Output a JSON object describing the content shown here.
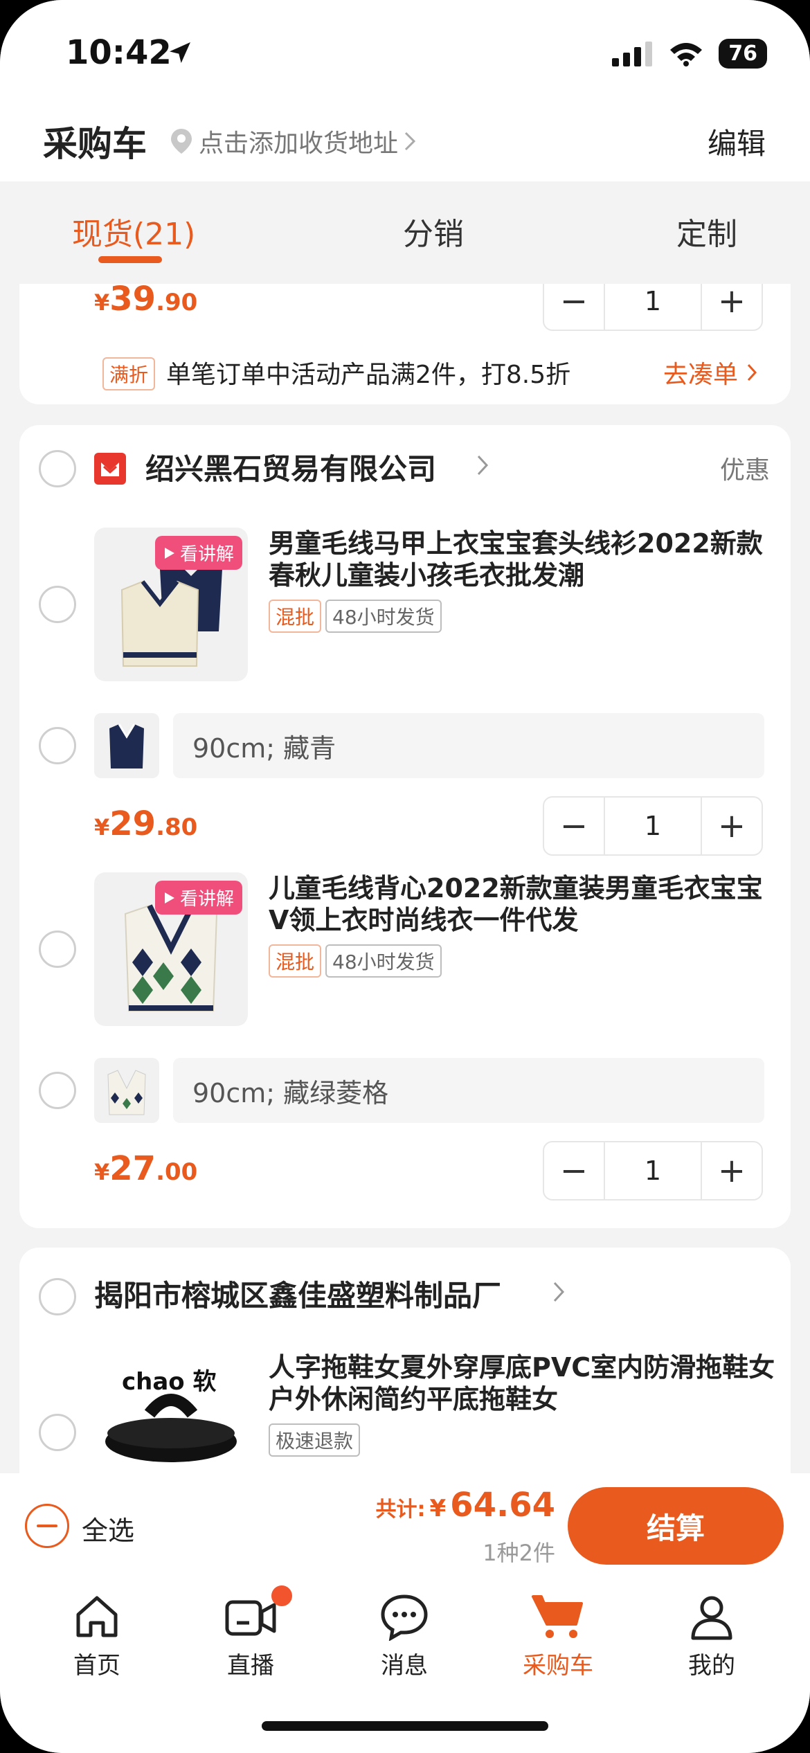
{
  "status_bar": {
    "time": "10:42",
    "battery": "76"
  },
  "header": {
    "title": "采购车",
    "address_prompt": "点击添加收货地址",
    "edit_label": "编辑"
  },
  "tabs": [
    {
      "label": "现货(21)",
      "active": true
    },
    {
      "label": "分销",
      "active": false
    },
    {
      "label": "定制",
      "active": false
    }
  ],
  "top_card": {
    "price": {
      "currency": "¥",
      "int": "39",
      "dec": ".90"
    },
    "quantity": "1",
    "promo_tag": "满折",
    "promo_text": "单笔订单中活动产品满2件，打8.5折",
    "promo_link": "去凑单"
  },
  "store1": {
    "name": "绍兴黑石贸易有限公司",
    "discount_label": "优惠",
    "products": [
      {
        "video_badge": "看讲解",
        "title": "男童毛线马甲上衣宝宝套头线衫2022新款春秋儿童装小孩毛衣批发潮",
        "tags": [
          "混批",
          "48小时发货"
        ],
        "variant": "90cm; 藏青",
        "price": {
          "currency": "¥",
          "int": "29",
          "dec": ".80"
        },
        "quantity": "1"
      },
      {
        "video_badge": "看讲解",
        "title": "儿童毛线背心2022新款童装男童毛衣宝宝V领上衣时尚线衣一件代发",
        "tags": [
          "混批",
          "48小时发货"
        ],
        "variant": "90cm; 藏绿菱格",
        "price": {
          "currency": "¥",
          "int": "27",
          "dec": ".00"
        },
        "quantity": "1"
      }
    ]
  },
  "store2": {
    "name": "揭阳市榕城区鑫佳盛塑料制品厂",
    "product": {
      "image_text": "chao 软",
      "title": "人字拖鞋女夏外穿厚底PVC室内防滑拖鞋女户外休闲简约平底拖鞋女",
      "tag": "极速退款"
    }
  },
  "checkout": {
    "select_all": "全选",
    "total_label": "共计:",
    "currency": "¥",
    "total": "64.64",
    "count": "1种2件",
    "pay_label": "结算"
  },
  "tabbar": [
    {
      "label": "首页",
      "icon": "home-icon"
    },
    {
      "label": "直播",
      "icon": "live-camera-icon"
    },
    {
      "label": "消息",
      "icon": "message-icon"
    },
    {
      "label": "采购车",
      "icon": "cart-icon",
      "active": true
    },
    {
      "label": "我的",
      "icon": "profile-icon"
    }
  ],
  "colors": {
    "accent": "#e85a1d",
    "video_badge": "#ef4f7a",
    "background": "#f3f3f3"
  }
}
